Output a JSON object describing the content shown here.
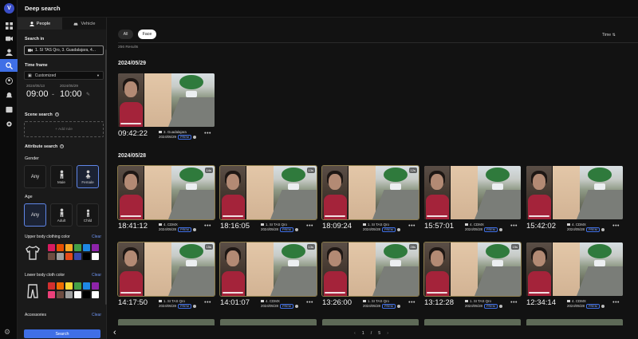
{
  "app": {
    "logo_letter": "V",
    "title": "Deep search"
  },
  "rail_icons": [
    "dashboard-icon",
    "camera-icon",
    "person-icon",
    "search-icon",
    "user-circle-icon",
    "bell-icon",
    "inbox-icon",
    "settings-icon"
  ],
  "panel": {
    "tabs": [
      {
        "label": "People",
        "icon": "person-icon"
      },
      {
        "label": "Vehicle",
        "icon": "car-icon"
      }
    ],
    "search_in": {
      "label": "Search in",
      "value": "1. SI TAS Qro, 3. Guadalajara, 4..."
    },
    "time_frame": {
      "label": "Time frame",
      "mode": "Customized",
      "start_date": "2024/05/13",
      "start_time": "09:00",
      "end_date": "2024/05/29",
      "end_time": "10:00"
    },
    "scene_search": {
      "label": "Scene search",
      "placeholder": "+ Add rule"
    },
    "attribute_search": {
      "label": "Attribute search",
      "gender": {
        "label": "Gender",
        "options": [
          "Any",
          "Male",
          "Female"
        ],
        "selected": "Female"
      },
      "age": {
        "label": "Age",
        "options": [
          "Any",
          "Adult",
          "Child"
        ],
        "selected": "Any"
      },
      "upper": {
        "label": "Upper body clothing color",
        "clear": "Clear",
        "colors": [
          "#d81b60",
          "#e65100",
          "#f9a825",
          "#43a047",
          "#1e88e5",
          "#8e24aa",
          "#6d4c41",
          "#9e9e9e",
          "#e64a19",
          "#3949ab",
          "#000000",
          "#ffffff"
        ]
      },
      "lower": {
        "label": "Lower body cloth color",
        "clear": "Clear",
        "colors": [
          "#d32f2f",
          "#ef6c00",
          "#fdd835",
          "#43a047",
          "#1e88e5",
          "#8e24aa",
          "#ec407a",
          "#6d4c41",
          "#9e9e9e",
          "#fafafa",
          "#000000",
          "#ffffff"
        ]
      },
      "accessories": {
        "label": "Accessories",
        "clear": "Clear"
      }
    },
    "search_button": "Search"
  },
  "main": {
    "filters": [
      "All",
      "Face"
    ],
    "sort": "Time",
    "results": "256 Results",
    "groups": [
      {
        "date": "2024/05/29",
        "cards": [
          {
            "time": "09:42:22",
            "camera": "3. Guadalajara",
            "date": "2024/05/29",
            "badge": "PREM",
            "flag": ""
          }
        ]
      },
      {
        "date": "2024/05/28",
        "cards": [
          {
            "time": "18:41:12",
            "camera": "4. CDMX",
            "date": "2024/05/28",
            "badge": "PREM",
            "flag": "14s"
          },
          {
            "time": "18:16:05",
            "camera": "1. SI TAS Qro",
            "date": "2024/05/28",
            "badge": "PREM",
            "flag": "13s"
          },
          {
            "time": "18:09:24",
            "camera": "1. SI TAS Qro",
            "date": "2024/05/28",
            "badge": "PREM",
            "flag": "12s"
          },
          {
            "time": "15:57:01",
            "camera": "4. CDMX",
            "date": "2024/05/28",
            "badge": "PREM",
            "flag": ""
          },
          {
            "time": "15:42:02",
            "camera": "4. CDMX",
            "date": "2024/05/28",
            "badge": "PREM",
            "flag": ""
          },
          {
            "time": "14:17:50",
            "camera": "1. SI TAS Qro",
            "date": "2024/05/28",
            "badge": "PREM",
            "flag": "15s"
          },
          {
            "time": "14:01:07",
            "camera": "4. CDMX",
            "date": "2024/05/28",
            "badge": "PREM",
            "flag": "13s"
          },
          {
            "time": "13:26:00",
            "camera": "1. SI TAS Qro",
            "date": "2024/05/28",
            "badge": "PREM",
            "flag": "28s"
          },
          {
            "time": "13:12:28",
            "camera": "1. SI TAS Qro",
            "date": "2024/05/28",
            "badge": "PREM",
            "flag": "15s"
          },
          {
            "time": "12:34:14",
            "camera": "4. CDMX",
            "date": "2024/05/28",
            "badge": "PREM",
            "flag": ""
          }
        ]
      }
    ],
    "pagination": {
      "current": "1",
      "separator": "/",
      "total": "5"
    }
  },
  "accent_color": "#3f6fe6"
}
